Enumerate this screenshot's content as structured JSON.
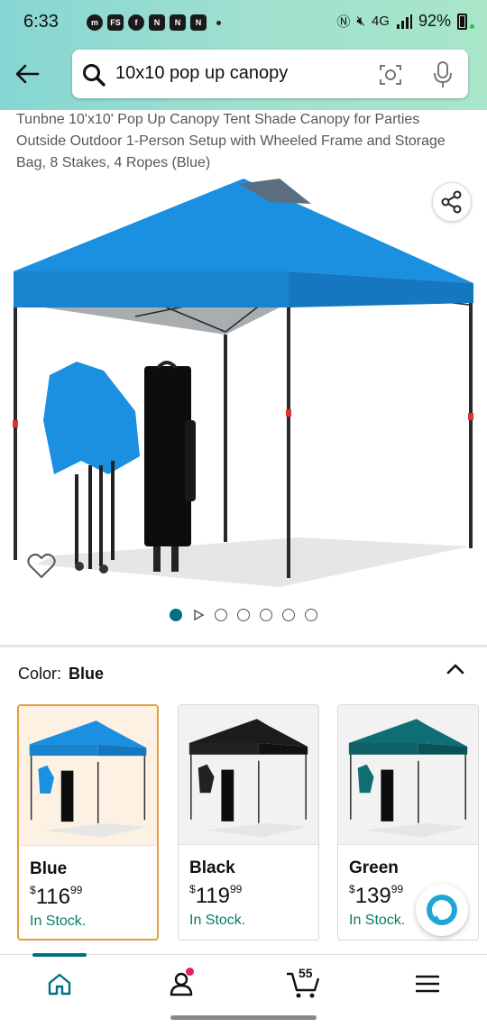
{
  "status_bar": {
    "time": "6:33",
    "battery": "92%",
    "network": "4G",
    "notification_icons": [
      "messenger-icon",
      "free-stuff-icon",
      "facebook-icon",
      "app-n-icon",
      "app-n-icon",
      "app-n-icon"
    ]
  },
  "search": {
    "query": "10x10 pop up canopy"
  },
  "product": {
    "title": "Tunbne 10'x10' Pop Up Canopy Tent Shade Canopy for Parties Outside Outdoor 1-Person Setup with Wheeled Frame and Storage Bag, 8 Stakes, 4 Ropes (Blue)",
    "image_count": 6,
    "active_image": 1
  },
  "color_selector": {
    "label": "Color:",
    "selected": "Blue",
    "options": [
      {
        "name": "Blue",
        "price_dollars": "116",
        "price_cents": "99",
        "currency": "$",
        "stock": "In Stock.",
        "canopy_color": "#1b8fe0"
      },
      {
        "name": "Black",
        "price_dollars": "119",
        "price_cents": "99",
        "currency": "$",
        "stock": "In Stock.",
        "canopy_color": "#1c1c1c"
      },
      {
        "name": "Green",
        "price_dollars": "139",
        "price_cents": "99",
        "currency": "$",
        "stock": "In Stock.",
        "canopy_color": "#116d74"
      }
    ]
  },
  "bottom_nav": {
    "cart_count": "55",
    "items": [
      "home-icon",
      "account-icon",
      "cart-icon",
      "menu-icon"
    ]
  },
  "colors": {
    "accent": "#007185",
    "selected_border": "#e09f42",
    "in_stock": "#067d62",
    "header_gradient_start": "#86d6d3",
    "header_gradient_end": "#a9e6c9"
  }
}
